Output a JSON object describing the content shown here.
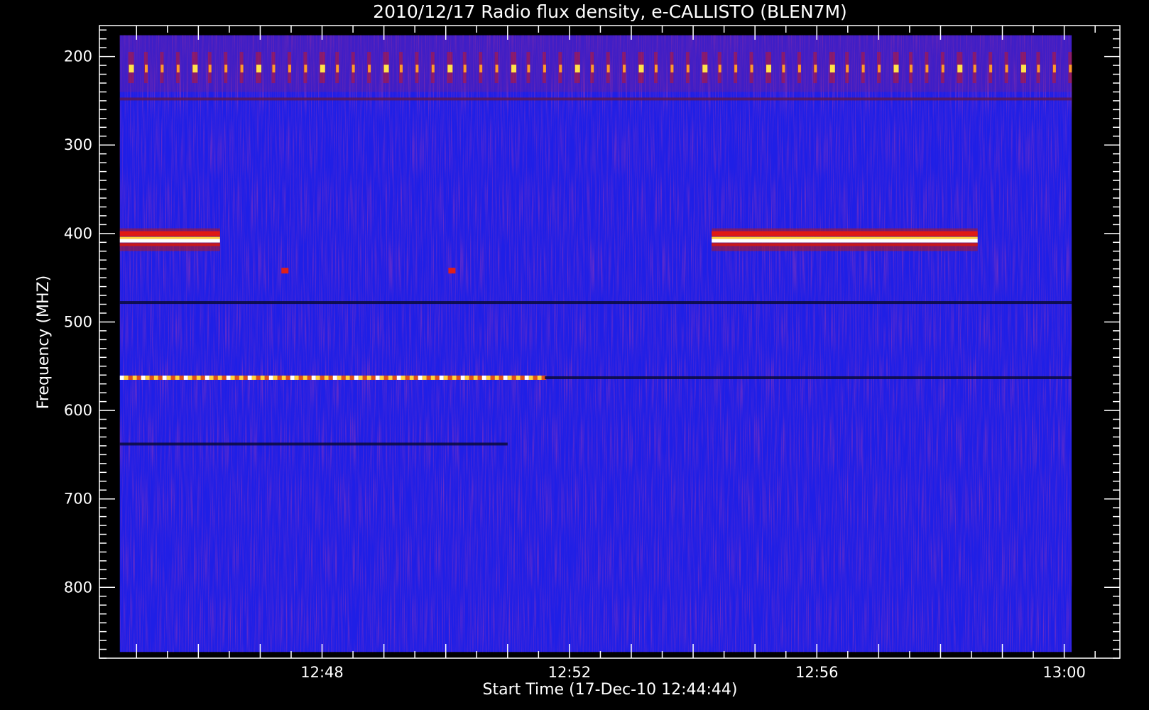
{
  "chart_data": {
    "type": "heatmap",
    "title": "2010/12/17  Radio flux density, e-CALLISTO (BLEN7M)",
    "xlabel": "Start Time (17-Dec-10 12:44:44)",
    "ylabel": "Frequency (MHZ)",
    "x_ticks": [
      "12:48",
      "12:52",
      "12:56",
      "13:00"
    ],
    "x_tick_minutes": [
      228,
      232,
      236,
      240
    ],
    "x_range_minutes": [
      224.4,
      240.9
    ],
    "data_x_range_minutes": [
      224.73,
      240.12
    ],
    "y_ticks": [
      200,
      300,
      400,
      500,
      600,
      700,
      800
    ],
    "y_range": [
      165,
      880
    ],
    "data_y_range": [
      176,
      873
    ],
    "y_inverted": true,
    "colors": {
      "background": "#000000",
      "field": "#1f1fe6",
      "axis": "#ffffff"
    },
    "features": [
      {
        "kind": "band",
        "freq": 407,
        "t_start": 224.73,
        "t_end": 226.35,
        "intensity": "white"
      },
      {
        "kind": "band",
        "freq": 407,
        "t_start": 234.3,
        "t_end": 238.6,
        "intensity": "white"
      },
      {
        "kind": "band",
        "freq": 563,
        "t_start": 224.73,
        "t_end": 231.6,
        "intensity": "yellow"
      },
      {
        "kind": "band",
        "freq": 563,
        "t_start": 231.6,
        "t_end": 240.12,
        "intensity": "dark"
      },
      {
        "kind": "band",
        "freq": 478,
        "t_start": 224.73,
        "t_end": 240.12,
        "intensity": "dark"
      },
      {
        "kind": "band",
        "freq": 248,
        "t_start": 224.73,
        "t_end": 240.12,
        "intensity": "dim"
      },
      {
        "kind": "band",
        "freq": 638,
        "t_start": 224.73,
        "t_end": 231.0,
        "intensity": "dark"
      },
      {
        "kind": "pulses",
        "freq": 214,
        "t_start": 224.9,
        "t_end": 240.1,
        "count": 60,
        "intensity": "yellow"
      },
      {
        "kind": "spot",
        "freq": 442,
        "t": 227.4,
        "intensity": "red"
      },
      {
        "kind": "spot",
        "freq": 442,
        "t": 230.1,
        "intensity": "red"
      }
    ]
  }
}
